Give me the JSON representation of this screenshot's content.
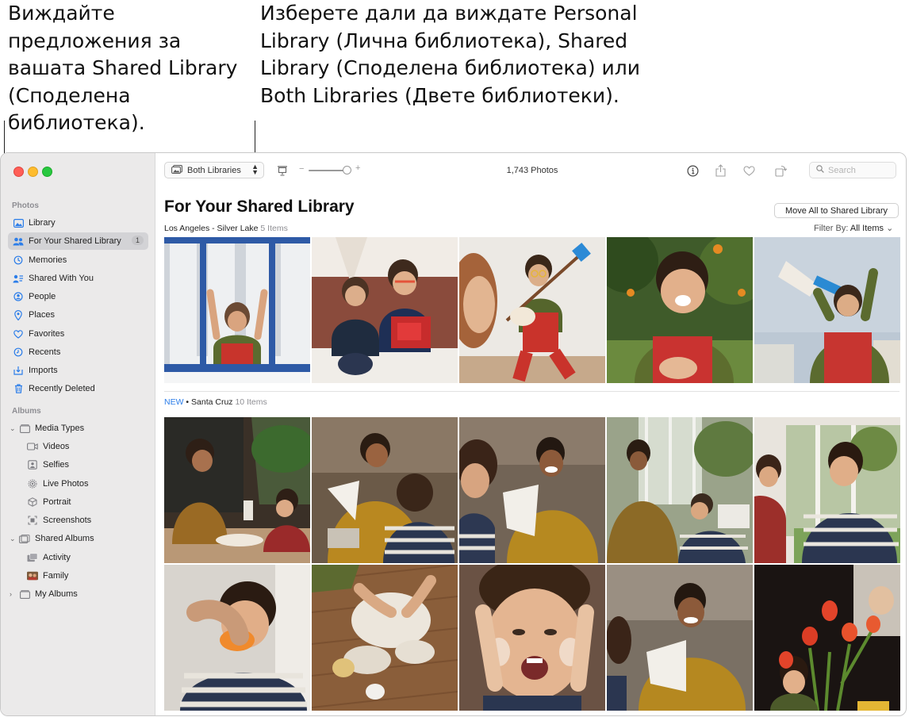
{
  "callouts": {
    "left": "Виждайте предложения за вашата Shared Library (Споделена библиотека).",
    "right": "Изберете дали да виждате Personal Library (Лична библиотека), Shared Library (Споделена библиотека) или Both Libraries (Двете библиотеки)."
  },
  "sidebar": {
    "photos_label": "Photos",
    "items": [
      {
        "label": "Library",
        "icon": "library-icon"
      },
      {
        "label": "For Your Shared Library",
        "icon": "people-icon",
        "badge": "1"
      },
      {
        "label": "Memories",
        "icon": "memories-icon"
      },
      {
        "label": "Shared With You",
        "icon": "shared-with-you-icon"
      },
      {
        "label": "People",
        "icon": "person-icon"
      },
      {
        "label": "Places",
        "icon": "pin-icon"
      },
      {
        "label": "Favorites",
        "icon": "heart-icon"
      },
      {
        "label": "Recents",
        "icon": "clock-icon"
      },
      {
        "label": "Imports",
        "icon": "import-icon"
      },
      {
        "label": "Recently Deleted",
        "icon": "trash-icon"
      }
    ],
    "albums_label": "Albums",
    "media_types": {
      "label": "Media Types",
      "items": [
        {
          "label": "Videos",
          "icon": "video-icon"
        },
        {
          "label": "Selfies",
          "icon": "selfie-icon"
        },
        {
          "label": "Live Photos",
          "icon": "live-photo-icon"
        },
        {
          "label": "Portrait",
          "icon": "cube-icon"
        },
        {
          "label": "Screenshots",
          "icon": "screenshot-icon"
        }
      ]
    },
    "shared_albums": {
      "label": "Shared Albums",
      "items": [
        {
          "label": "Activity",
          "icon": "activity-icon"
        },
        {
          "label": "Family",
          "icon": "family-thumbnail"
        }
      ]
    },
    "my_albums": "My Albums"
  },
  "toolbar": {
    "library_selector": "Both Libraries",
    "photo_count": "1,743 Photos",
    "zoom_minus": "−",
    "zoom_plus": "+",
    "zoom_level": 0.85,
    "search_placeholder": "Search"
  },
  "content": {
    "title": "For Your Shared Library",
    "move_button": "Move All to Shared Library",
    "filter_label": "Filter By:",
    "filter_value": "All Items",
    "groups": [
      {
        "badge": "",
        "name": "Los Angeles - Silver Lake",
        "count": "5 Items"
      },
      {
        "badge": "NEW",
        "name": " • Santa Cruz",
        "count": "10 Items"
      }
    ]
  },
  "colors": {
    "accent": "#2b7de9",
    "sidebar_bg": "#ebeaea",
    "selected_bg": "#d3d3d6"
  }
}
